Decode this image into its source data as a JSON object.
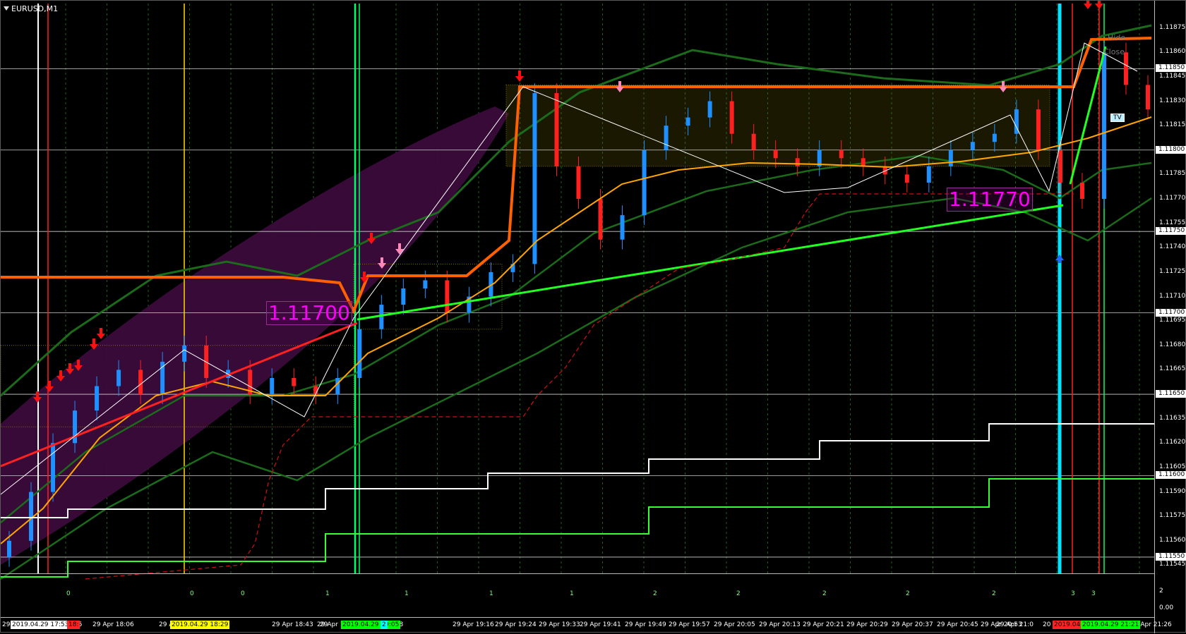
{
  "window": {
    "title": "EURUSD,M1"
  },
  "price_axis": {
    "labels": [
      "1.11875",
      "1.11860",
      "1.11845",
      "1.11830",
      "1.11815",
      "1.11785",
      "1.11770",
      "1.11755",
      "1.11740",
      "1.11725",
      "1.11710",
      "1.11695",
      "1.11680",
      "1.11665",
      "1.11635",
      "1.11620",
      "1.11605",
      "1.11590",
      "1.11575",
      "1.11560",
      "1.11545"
    ],
    "boxes": [
      "1.11850",
      "1.11800",
      "1.11750",
      "1.11700",
      "1.11650",
      "1.11600",
      "1.11550"
    ]
  },
  "sub_axis": {
    "top": "2",
    "bottom": "0.00"
  },
  "time_axis": {
    "labels": [
      "29 Apr 18:06",
      "29 Apr 18:43",
      "29 Apr 18:51",
      "29 Apr 19:16",
      "29 Apr 19:24",
      "29 Apr 19:33",
      "29 Apr 19:41",
      "29 Apr 19:49",
      "29 Apr 19:57",
      "29 Apr 20:05",
      "29 Apr 20:13",
      "29 Apr 20:21",
      "29 Apr 20:29",
      "29 Apr 20:37",
      "29 Apr 20:45",
      "29 Apr 20:53",
      "29 Apr 21:26"
    ],
    "fragments": [
      "29",
      "55",
      "29 Ap",
      ":29",
      "29",
      "9:08",
      "29 Apr 21:0",
      "20"
    ],
    "highlights": [
      {
        "text": "2019.04.29 17:53",
        "color": "#ffffff"
      },
      {
        "text": "18:",
        "color": "#ff2222"
      },
      {
        "text": "2019.04.29 18:29",
        "color": "#ffff00"
      },
      {
        "text": "2019.04.29 19:05",
        "color": "#00ff00"
      },
      {
        "text": "2",
        "color": "#00ffff"
      },
      {
        "text": "2019.04.2",
        "color": "#ff2222"
      },
      {
        "text": "2019.04.29 21:21",
        "color": "#00ff00"
      }
    ]
  },
  "subwindow_counts": [
    "0",
    "0",
    "0",
    "1",
    "1",
    "1",
    "1",
    "2",
    "2",
    "2",
    "2",
    "2",
    "3",
    "3"
  ],
  "annotations": {
    "price_label_1": "1.11700",
    "price_label_2": "1.11770",
    "hide_label": "Hide",
    "close_label": "Close",
    "tv_label": "TV"
  },
  "chart_data": {
    "type": "candlestick",
    "symbol": "EURUSD",
    "timeframe": "M1",
    "ylim": [
      1.1154,
      1.1189
    ],
    "levels": [
      1.1185,
      1.118,
      1.1175,
      1.117,
      1.1165,
      1.116,
      1.1155
    ],
    "close_path": [
      1.1156,
      1.1159,
      1.1162,
      1.1164,
      1.11655,
      1.11665,
      1.1165,
      1.1167,
      1.1168,
      1.1166,
      1.11665,
      1.1165,
      1.1166,
      1.11655,
      1.1165,
      1.1166,
      1.1169,
      1.11705,
      1.11715,
      1.1172,
      1.117,
      1.1171,
      1.11725,
      1.1173,
      1.11835,
      1.1179,
      1.1177,
      1.11745,
      1.1176,
      1.118,
      1.11815,
      1.1182,
      1.1183,
      1.1181,
      1.118,
      1.11795,
      1.1179,
      1.118,
      1.11795,
      1.1179,
      1.11785,
      1.1178,
      1.1179,
      1.118,
      1.11805,
      1.1181,
      1.11825,
      1.118,
      1.1178,
      1.1177,
      1.1186,
      1.1184,
      1.11825
    ],
    "colors": {
      "up": "#1e90ff",
      "down": "#ff2020",
      "bands": "#1a7a1a",
      "ma": "#ffa500",
      "resistance": "#ff6000"
    }
  }
}
